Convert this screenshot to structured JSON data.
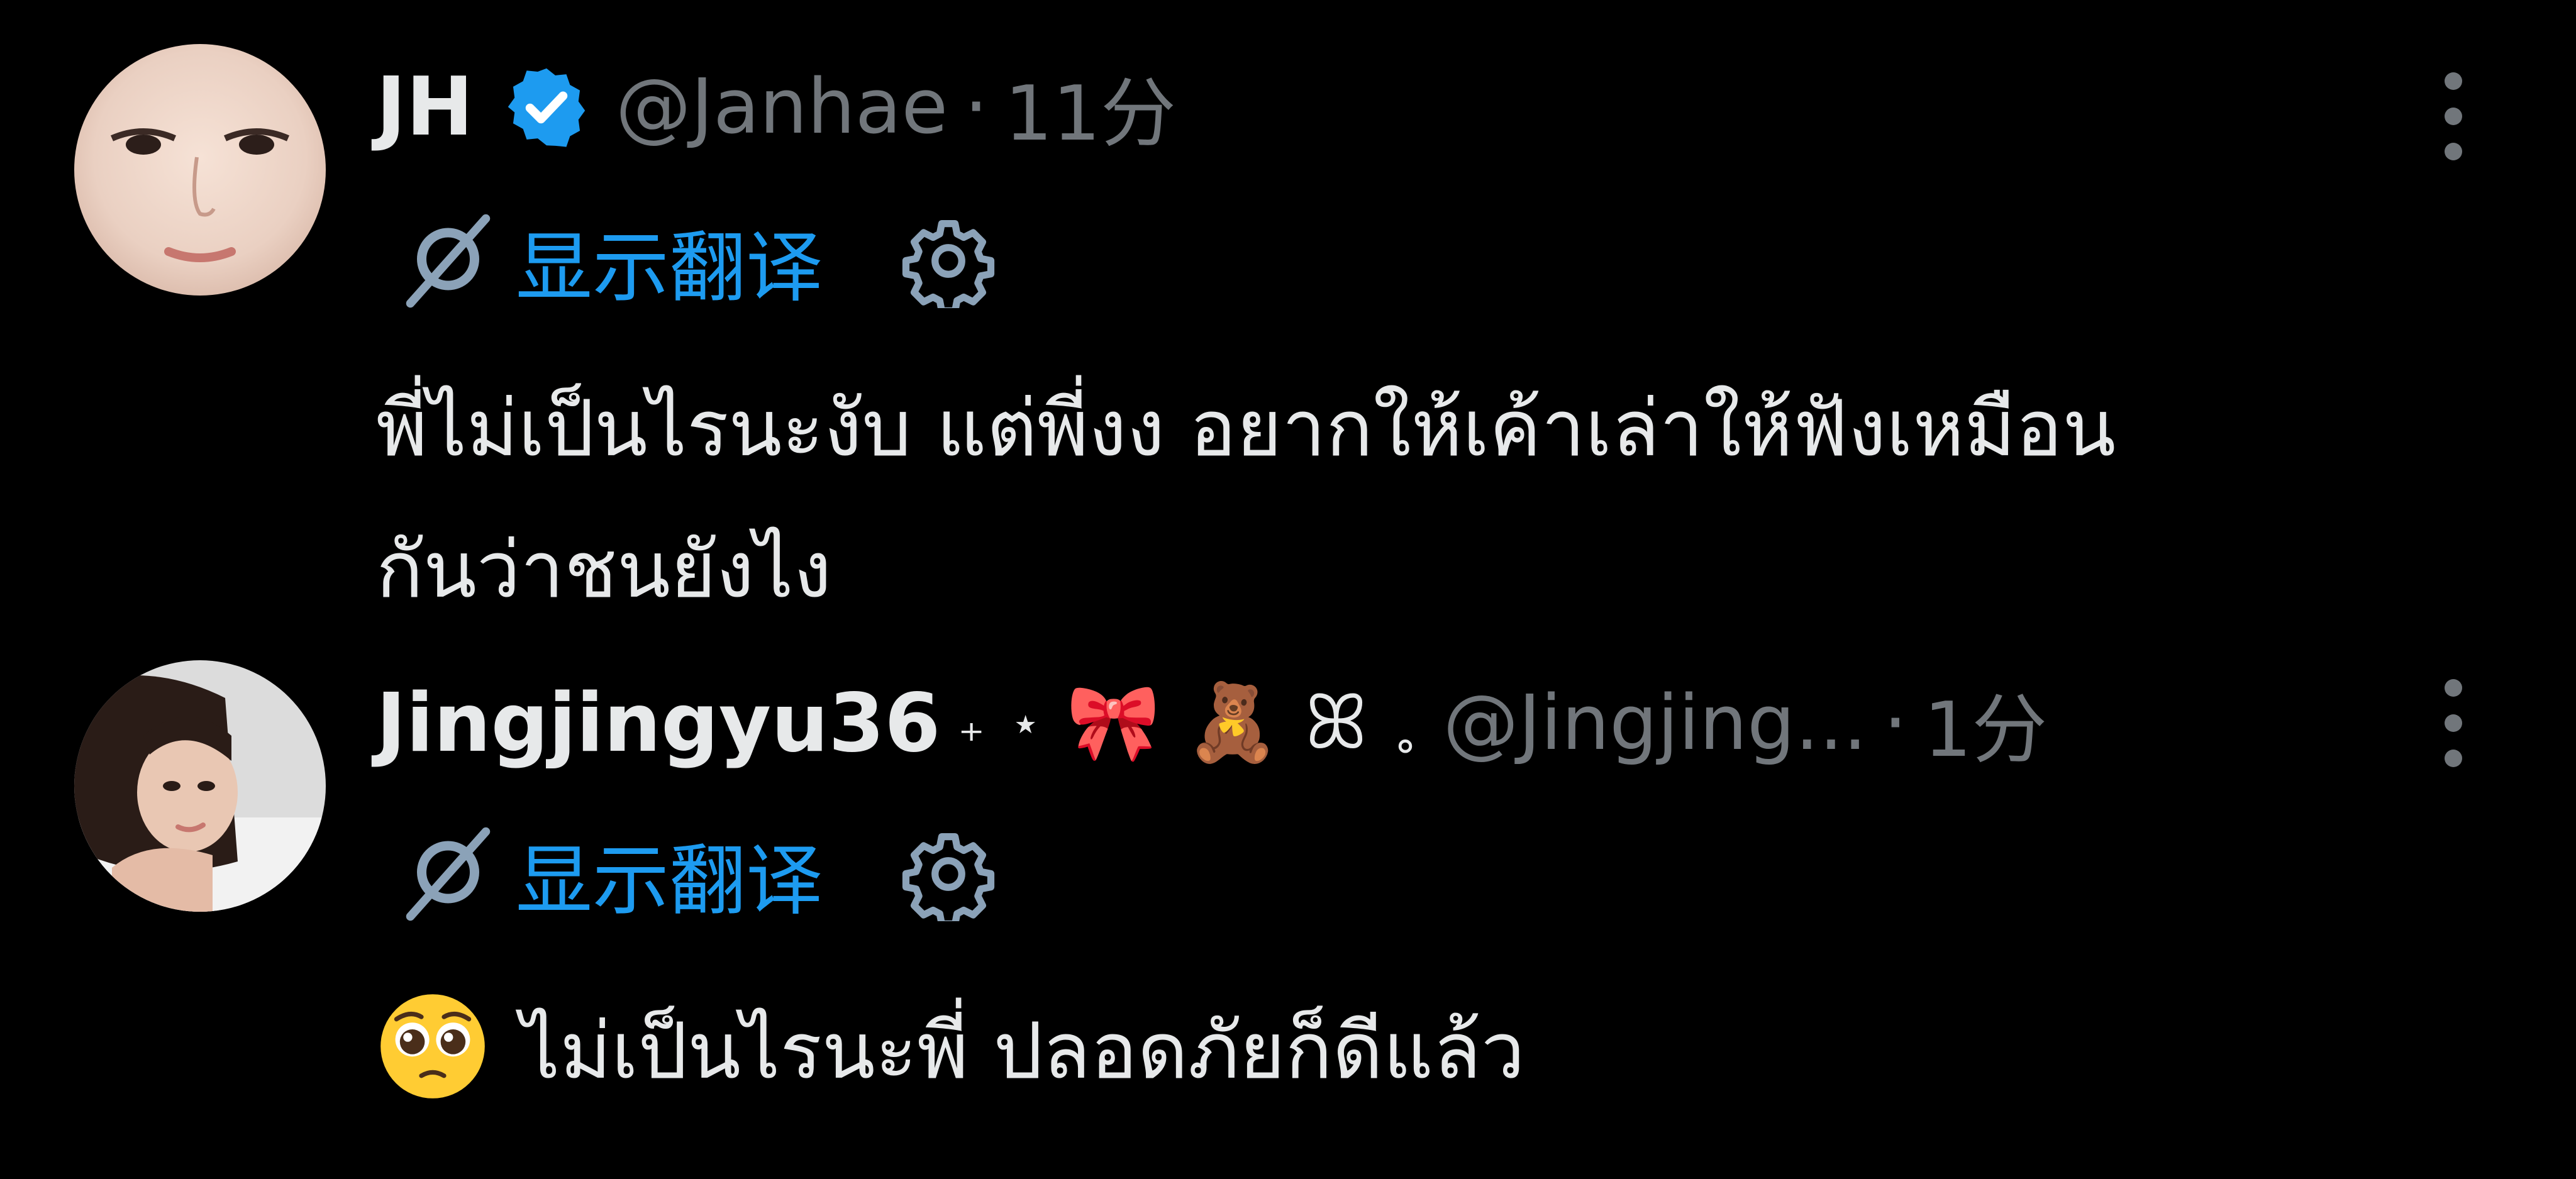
{
  "tweets": [
    {
      "display_name": "JH",
      "verified": true,
      "handle": "@Janhae",
      "separator": "·",
      "time": "11分",
      "translate_label": "显示翻译",
      "text": "พี่ไม่เป็นไรนะงับ แต่พี่งง อยากให้เค้าเล่าให้ฟังเหมือน\nกันว่าชนยังไง"
    },
    {
      "display_name": "Jingjingyu36",
      "name_decorations": [
        "₊",
        "⋆",
        "🎀",
        "🧸",
        "ꕤ",
        "˳"
      ],
      "handle": "@Jingjing...",
      "separator": "·",
      "time": "1分",
      "translate_label": "显示翻译",
      "text_emoji": "pleading-face",
      "text": "ไม่เป็นไรนะพี่ ปลอดภัยก็ดีแล้ว"
    }
  ],
  "colors": {
    "background": "#000000",
    "primary_text": "#e7e9ea",
    "secondary_text": "#71767b",
    "accent": "#1d9bf0",
    "translate_icon": "#8ba2b8"
  },
  "icons": {
    "verified": "verified-badge-icon",
    "translate": "translate-globe-icon",
    "settings": "gear-icon",
    "more": "more-vertical-icon"
  }
}
